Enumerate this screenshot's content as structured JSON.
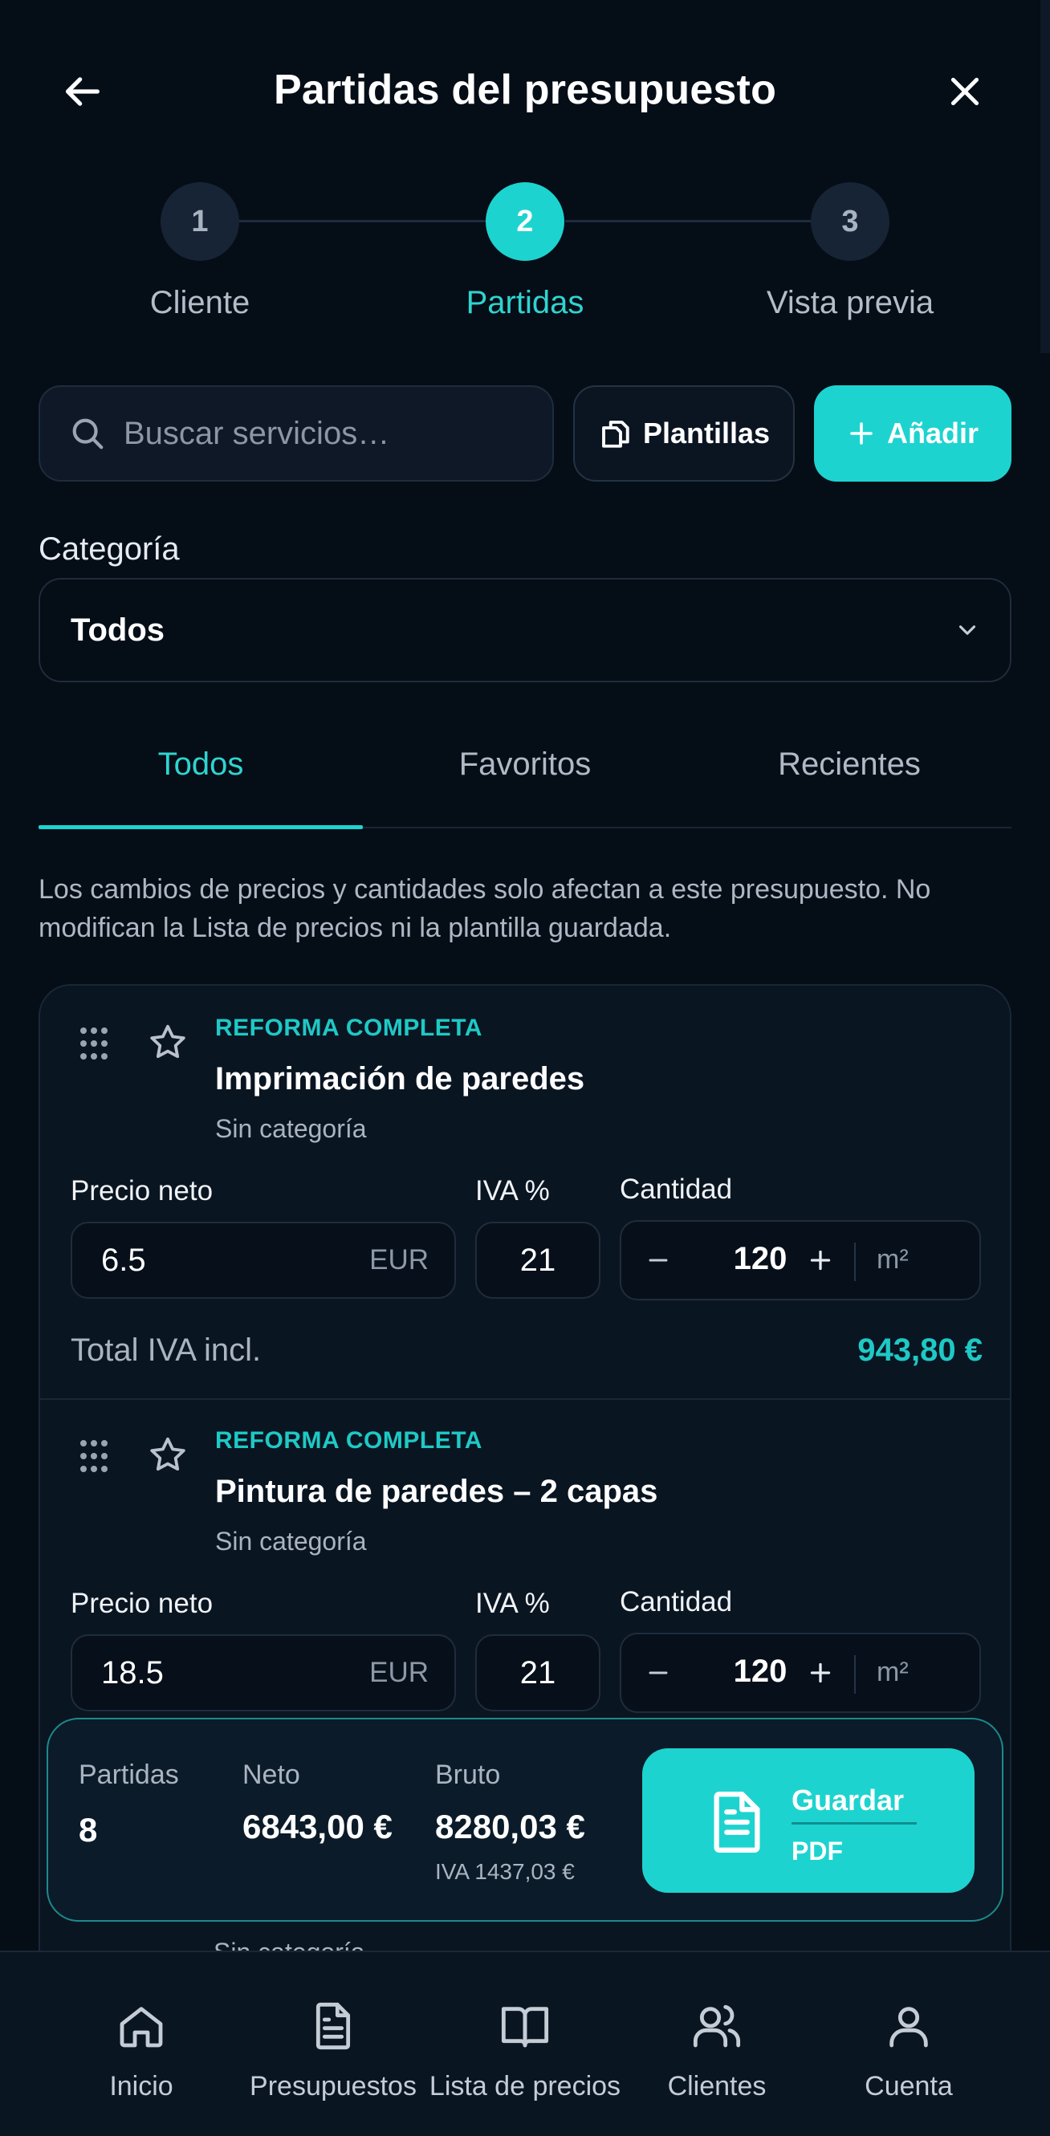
{
  "header": {
    "title": "Partidas del presupuesto",
    "back_icon": "arrow-left-icon",
    "close_icon": "close-icon"
  },
  "stepper": {
    "steps": [
      {
        "number": "1",
        "label": "Cliente",
        "state": "done"
      },
      {
        "number": "2",
        "label": "Partidas",
        "state": "active"
      },
      {
        "number": "3",
        "label": "Vista previa",
        "state": "upcoming"
      }
    ]
  },
  "toolbar": {
    "search_placeholder": "Buscar servicios…",
    "templates_label": "Plantillas",
    "add_label": "Añadir"
  },
  "category": {
    "label": "Categoría",
    "selected": "Todos"
  },
  "tabs": [
    {
      "label": "Todos",
      "active": true
    },
    {
      "label": "Favoritos",
      "active": false
    },
    {
      "label": "Recientes",
      "active": false
    }
  ],
  "notice": "Los cambios de precios y cantidades solo afectan a este presupuesto. No modifican la Lista de precios ni la plantilla guardada.",
  "items": [
    {
      "tag": "REFORMA COMPLETA",
      "title": "Imprimación de paredes",
      "category": "Sin categoría",
      "price_label": "Precio neto",
      "price": "6.5",
      "currency": "EUR",
      "vat_label": "IVA %",
      "vat": "21",
      "qty_label": "Cantidad",
      "qty": "120",
      "unit": "m²",
      "total_label": "Total IVA incl.",
      "total": "943,80 €"
    },
    {
      "tag": "REFORMA COMPLETA",
      "title": "Pintura de paredes – 2 capas",
      "category": "Sin categoría",
      "price_label": "Precio neto",
      "price": "18.5",
      "currency": "EUR",
      "vat_label": "IVA %",
      "vat": "21",
      "qty_label": "Cantidad",
      "qty": "120",
      "unit": "m²"
    }
  ],
  "peek_item_category": "Sin categoría",
  "summary": {
    "items_label": "Partidas",
    "items_count": "8",
    "net_label": "Neto",
    "net": "6843,00 €",
    "gross_label": "Bruto",
    "gross": "8280,03 €",
    "vat_text": "IVA 1437,03 €",
    "save_label": "Guardar",
    "save_sub": "PDF"
  },
  "nav": [
    {
      "label": "Inicio",
      "icon": "home-icon"
    },
    {
      "label": "Presupuestos",
      "icon": "document-icon"
    },
    {
      "label": "Lista de precios",
      "icon": "book-icon"
    },
    {
      "label": "Clientes",
      "icon": "users-icon"
    },
    {
      "label": "Cuenta",
      "icon": "user-icon"
    }
  ],
  "colors": {
    "background": "#050d17",
    "accent": "#1dd3cf",
    "surface": "#0a1522"
  }
}
